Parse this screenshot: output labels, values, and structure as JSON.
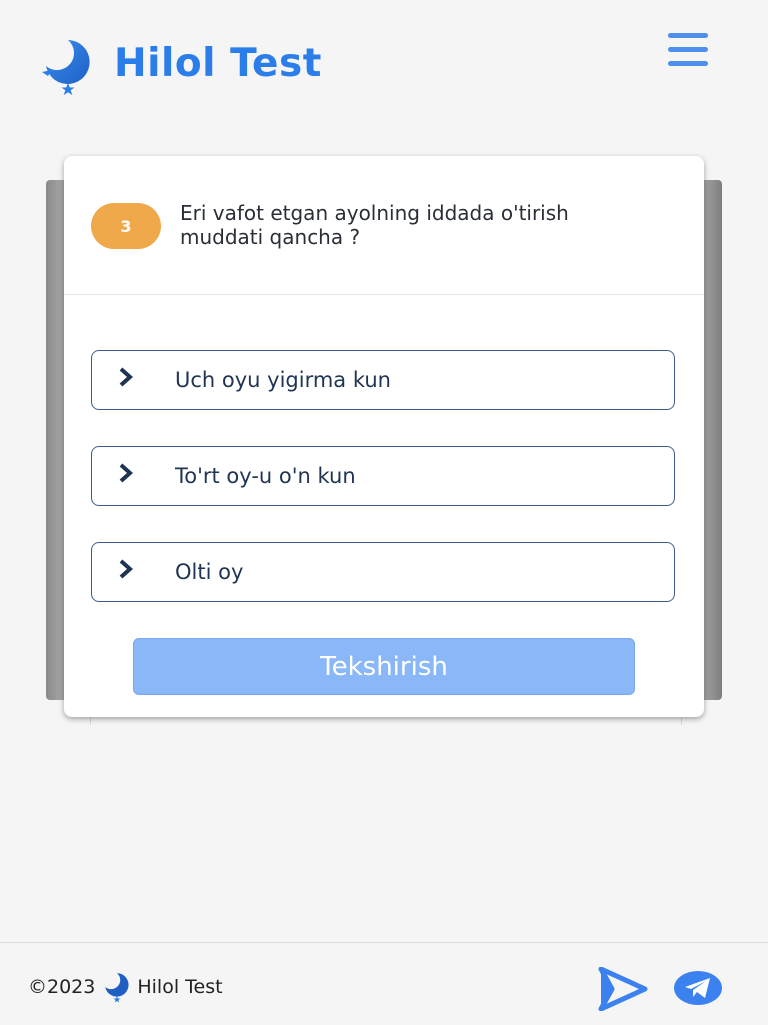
{
  "header": {
    "brand": "Hilol Test",
    "logo_icon": "crescent-moon-star-icon",
    "menu_icon": "hamburger-menu-icon"
  },
  "question": {
    "number": "3",
    "text": "Eri vafot etgan ayolning iddada o'tirish muddati qancha ?"
  },
  "options": [
    {
      "label": "Uch oyu yigirma kun"
    },
    {
      "label": "To'rt oy-u o'n kun"
    },
    {
      "label": "Olti oy"
    }
  ],
  "check_button": {
    "label": "Tekshirish"
  },
  "footer": {
    "copyright": "©2023",
    "brand": "Hilol Test",
    "play_icon": "google-play-icon",
    "telegram_icon": "telegram-icon"
  },
  "colors": {
    "brand": "#2b7de9",
    "badge": "#f0a94a",
    "option_border": "#3d5c8a",
    "button_bg": "#8ab7f7"
  }
}
